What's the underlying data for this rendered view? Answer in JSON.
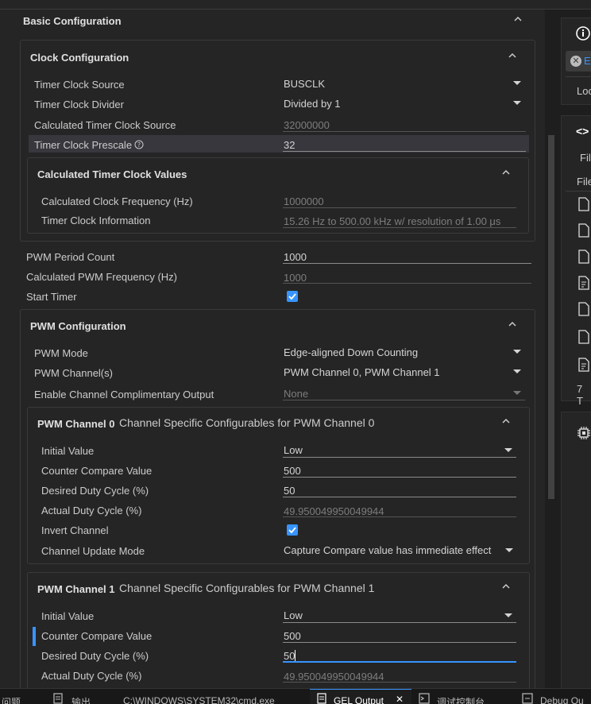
{
  "basic": {
    "title": "Basic Configuration"
  },
  "clock": {
    "title": "Clock Configuration",
    "source_label": "Timer Clock Source",
    "source_value": "BUSCLK",
    "divider_label": "Timer Clock Divider",
    "divider_value": "Divided by 1",
    "calc_source_label": "Calculated Timer Clock Source",
    "calc_source_value": "32000000",
    "prescale_label": "Timer Clock Prescale",
    "prescale_value": "32",
    "values_title": "Calculated Timer Clock Values",
    "freq_label": "Calculated Clock Frequency (Hz)",
    "freq_value": "1000000",
    "info_label": "Timer Clock Information",
    "info_value": "15.26 Hz to 500.00 kHz w/ resolution of 1.00 μs"
  },
  "pwm_period_label": "PWM Period Count",
  "pwm_period_value": "1000",
  "pwm_freq_label": "Calculated PWM Frequency (Hz)",
  "pwm_freq_value": "1000",
  "start_timer_label": "Start Timer",
  "start_timer_checked": true,
  "pwm": {
    "title": "PWM Configuration",
    "mode_label": "PWM Mode",
    "mode_value": "Edge-aligned Down Counting",
    "channels_label": "PWM Channel(s)",
    "channels_value": "PWM Channel 0, PWM Channel 1",
    "comp_label": "Enable Channel Complimentary Output",
    "comp_value": "None"
  },
  "ch0": {
    "name": "PWM Channel 0",
    "desc": "Channel Specific Configurables for PWM Channel 0",
    "init_label": "Initial Value",
    "init_value": "Low",
    "ccv_label": "Counter Compare Value",
    "ccv_value": "500",
    "duty_label": "Desired Duty Cycle (%)",
    "duty_value": "50",
    "actual_label": "Actual Duty Cycle (%)",
    "actual_value": "49.950049950049944",
    "invert_label": "Invert Channel",
    "invert_checked": true,
    "update_label": "Channel Update Mode",
    "update_value": "Capture Compare value has immediate effect"
  },
  "ch1": {
    "name": "PWM Channel 1",
    "desc": "Channel Specific Configurables for PWM Channel 1",
    "init_label": "Initial Value",
    "init_value": "Low",
    "ccv_label": "Counter Compare Value",
    "ccv_value": "500",
    "duty_label": "Desired Duty Cycle (%)",
    "duty_value": "50",
    "actual_label": "Actual Duty Cycle (%)",
    "actual_value": "49.950049950049944"
  },
  "right": {
    "btn_text": "E",
    "loc_text": "Loc",
    "fil_text": "Fil",
    "file_text": "File",
    "count_text": "7 T"
  },
  "bottom": {
    "tab1": "问题",
    "tab2": "输出",
    "tab3": "C:\\WINDOWS\\SYSTEM32\\cmd.exe",
    "tab4": "GEL Output",
    "tab5": "调试控制台",
    "tab6": "Debug Ou"
  },
  "colors": {
    "accent": "#3794ff",
    "panel": "#252526",
    "bg": "#1e1e1e"
  }
}
